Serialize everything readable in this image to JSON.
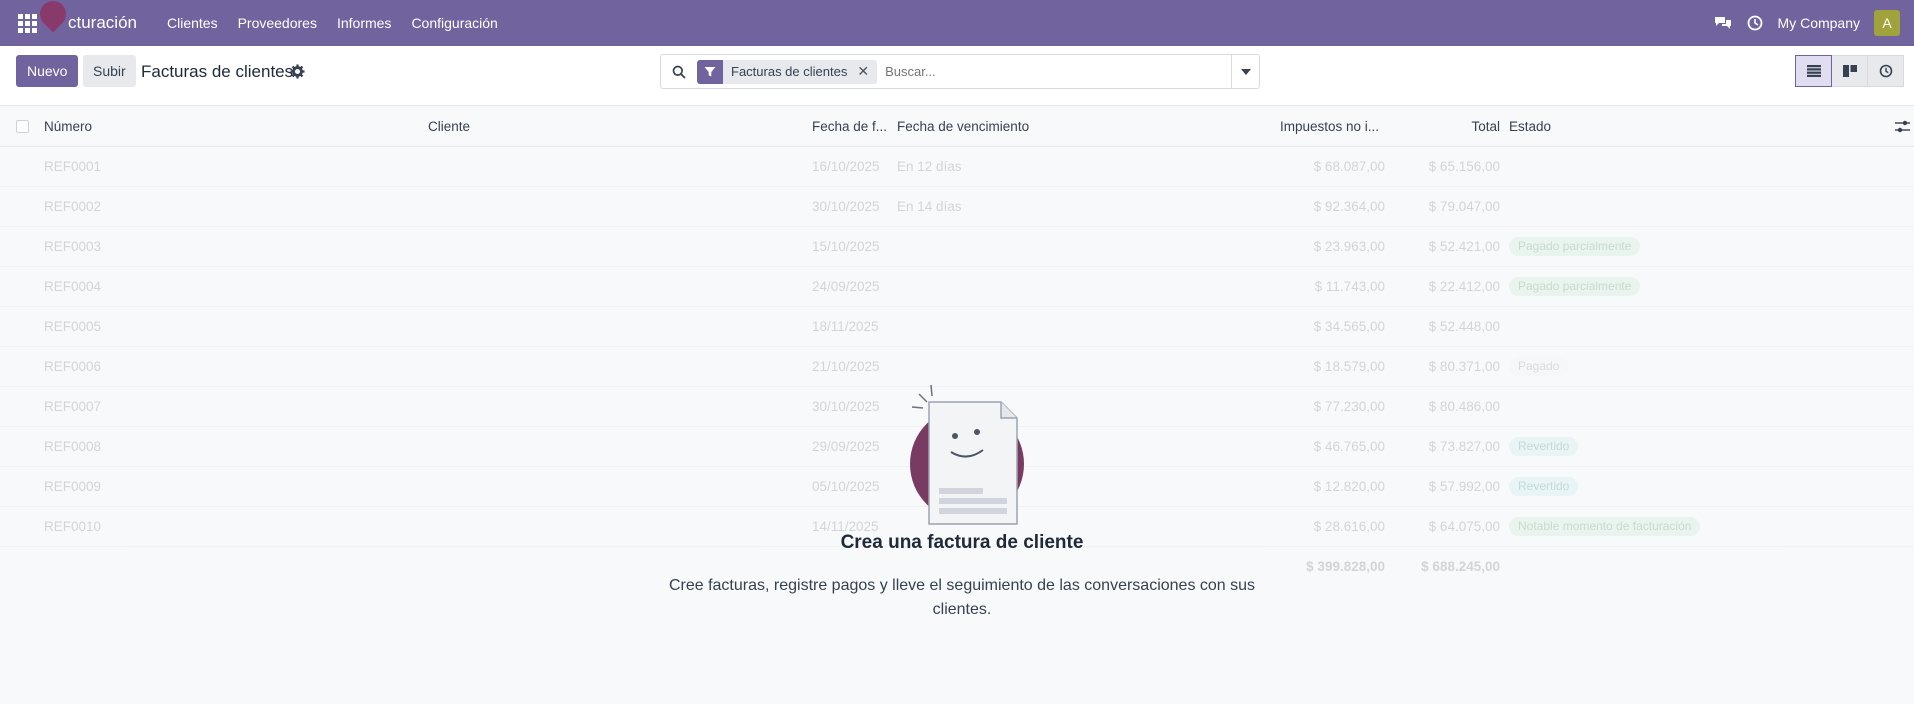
{
  "navbar": {
    "app_name": "cturación",
    "menu": [
      "Clientes",
      "Proveedores",
      "Informes",
      "Configuración"
    ],
    "company": "My Company",
    "avatar_letter": "A",
    "color": "#71639e"
  },
  "control": {
    "new_label": "Nuevo",
    "upload_label": "Subir",
    "breadcrumb": "Facturas de clientes",
    "search": {
      "facet_label": "Facturas de clientes",
      "placeholder": "Buscar..."
    }
  },
  "columns": [
    "Número",
    "Cliente",
    "Fecha de f...",
    "Fecha de vencimiento",
    "Impuestos no i...",
    "Total",
    "Estado"
  ],
  "rows": [
    {
      "num": "REF0001",
      "date": "16/10/2025",
      "due": "En 12 días",
      "tax": "$ 68.087,00",
      "total": "$ 65.156,00",
      "status": ""
    },
    {
      "num": "REF0002",
      "date": "30/10/2025",
      "due": "En 14 días",
      "tax": "$ 92.364,00",
      "total": "$ 79.047,00",
      "status": ""
    },
    {
      "num": "REF0003",
      "date": "15/10/2025",
      "due": "",
      "tax": "$ 23.963,00",
      "total": "$ 52.421,00",
      "status": "Pagado parcialmente"
    },
    {
      "num": "REF0004",
      "date": "24/09/2025",
      "due": "",
      "tax": "$ 11.743,00",
      "total": "$ 22.412,00",
      "status": "Pagado parcialmente"
    },
    {
      "num": "REF0005",
      "date": "18/11/2025",
      "due": "",
      "tax": "$ 34.565,00",
      "total": "$ 52.448,00",
      "status": ""
    },
    {
      "num": "REF0006",
      "date": "21/10/2025",
      "due": "",
      "tax": "$ 18.579,00",
      "total": "$ 80.371,00",
      "status": "Pagado"
    },
    {
      "num": "REF0007",
      "date": "30/10/2025",
      "due": "",
      "tax": "$ 77.230,00",
      "total": "$ 80.486,00",
      "status": ""
    },
    {
      "num": "REF0008",
      "date": "29/09/2025",
      "due": "",
      "tax": "$ 46.765,00",
      "total": "$ 73.827,00",
      "status": "Revertido"
    },
    {
      "num": "REF0009",
      "date": "05/10/2025",
      "due": "",
      "tax": "$ 12.820,00",
      "total": "$ 57.992,00",
      "status": "Revertido"
    },
    {
      "num": "REF0010",
      "date": "14/11/2025",
      "due": "",
      "tax": "$ 28.616,00",
      "total": "$ 64.075,00",
      "status": "Notable momento de facturación"
    }
  ],
  "totals": {
    "tax": "$ 399.828,00",
    "total": "$ 688.245,00"
  },
  "empty_state": {
    "title": "Crea una factura de cliente",
    "text": "Cree facturas, registre pagos y lleve el seguimiento de las conversaciones con sus clientes."
  }
}
